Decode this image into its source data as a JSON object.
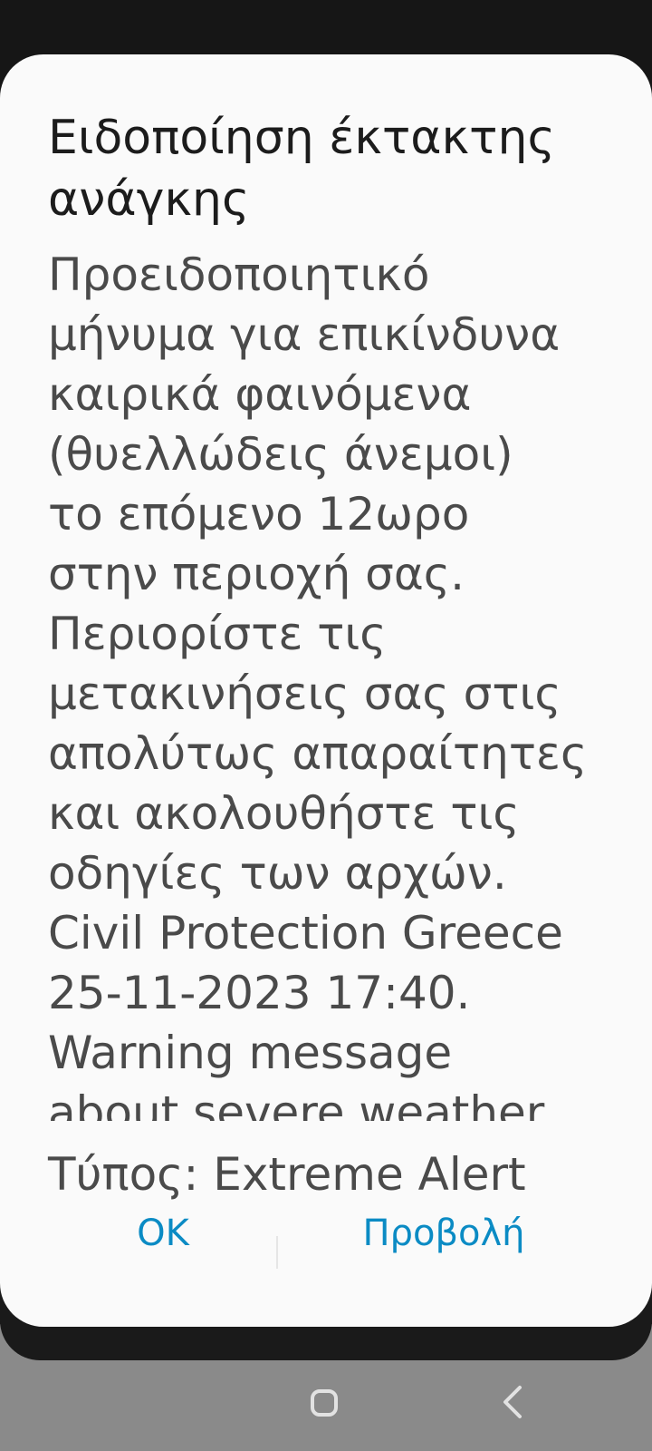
{
  "dialog": {
    "title": "Ειδοποίηση έκτακτης ανάγκης",
    "message": "Προειδοποιητικό\nμήνυμα για επικίνδυνα\nκαιρικά φαινόμενα\n(θυελλώδεις άνεμοι)\nτο επόμενο 12ωρο\nστην περιοχή σας.\nΠεριορίστε τις\nμετακινήσεις σας στις\nαπολύτως απαραίτητες\nκαι ακολουθήστε τις\nοδηγίες των αρχών.\nCivil Protection Greece\n25-11-2023 17:40.\nWarning message\nabout severe weather",
    "type_line": "Τύπος: Extreme Alert",
    "ok_label": "OK",
    "view_label": "Προβολή"
  },
  "navigation_bar": {
    "home_icon": "home-square-icon",
    "back_icon": "back-chevron-icon"
  },
  "colors": {
    "accent": "#0b8bc4",
    "dialog_background": "#fafafa",
    "screen_background": "#161616",
    "nav_background": "#8a8a8a"
  }
}
